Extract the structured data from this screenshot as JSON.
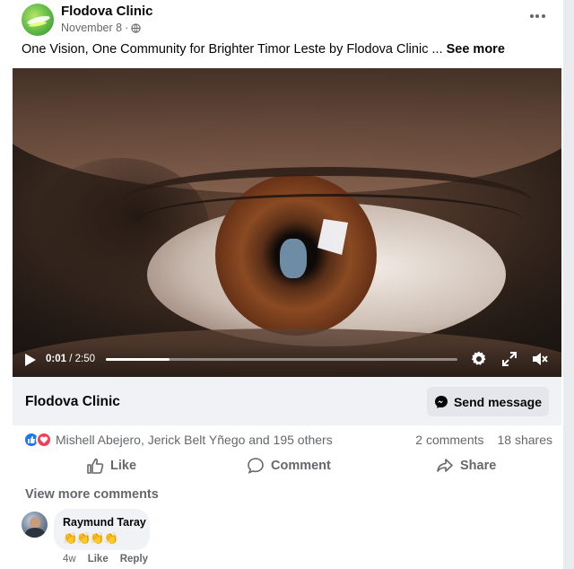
{
  "post": {
    "page_name": "Flodova Clinic",
    "date": "November 8",
    "separator": "·",
    "privacy_icon": "globe-icon",
    "caption": "One Vision, One Community for Brighter Timor Leste by Flodova Clinic ...",
    "see_more": "See more"
  },
  "video": {
    "current_time": "0:01",
    "duration": "/ 2:50",
    "progress": 0.18,
    "icons": [
      "play-icon",
      "settings-icon",
      "fullscreen-icon",
      "mute-icon"
    ]
  },
  "page_bar": {
    "name": "Flodova Clinic",
    "send_message": "Send message"
  },
  "reactions": {
    "names": "Mishell Abejero, Jerick Belt Yñego and 195 others",
    "comments": "2 comments",
    "shares": "18 shares"
  },
  "actions": {
    "like": "Like",
    "comment": "Comment",
    "share": "Share"
  },
  "comments": {
    "view_more": "View more comments",
    "items": [
      {
        "author": "Raymund Taray",
        "text": "👏👏👏👏",
        "age": "4w",
        "like": "Like",
        "reply": "Reply"
      }
    ]
  },
  "colors": {
    "brand_blue": "#1877f2",
    "love_red": "#f33e58",
    "secondary_text": "#65676b",
    "bar_bg": "#f0f2f5"
  }
}
